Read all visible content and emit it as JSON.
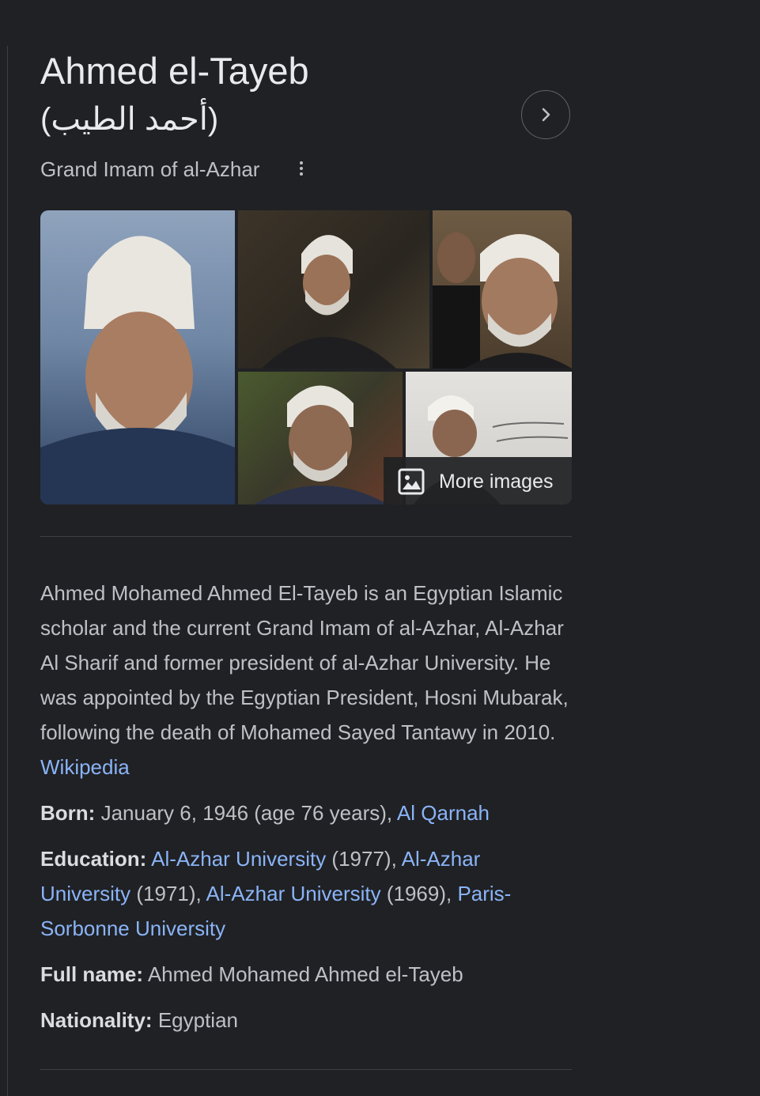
{
  "header": {
    "title": "Ahmed el-Tayeb",
    "native_name": "(أحمد الطيب)",
    "subtitle": "Grand Imam of al-Azhar",
    "next_icon": "chevron-right-icon",
    "menu_icon": "more-vert-icon"
  },
  "gallery": {
    "more_images_label": "More images",
    "more_images_icon": "image-icon"
  },
  "description": {
    "text": "Ahmed Mohamed Ahmed El-Tayeb is an Egyptian Islamic scholar and the current Grand Imam of al-Azhar, Al-Azhar Al Sharif and former president of al-Azhar University. He was appointed by the Egyptian President, Hosni Mubarak, following the death of Mohamed Sayed Tantawy in 2010.",
    "source_link": "Wikipedia"
  },
  "facts": {
    "born": {
      "label": "Born:",
      "value": "January 6, 1946 (age 76 years), ",
      "link": "Al Qarnah"
    },
    "education": {
      "label": "Education:",
      "link1": "Al-Azhar University",
      "year1": " (1977), ",
      "link2": "Al-Azhar University",
      "year2": " (1971), ",
      "link3": "Al-Azhar University",
      "year3": " (1969), ",
      "link4": "Paris-Sorbonne University"
    },
    "full_name": {
      "label": "Full name:",
      "value": "Ahmed Mohamed Ahmed el-Tayeb"
    },
    "nationality": {
      "label": "Nationality:",
      "value": "Egyptian"
    }
  },
  "colors": {
    "background": "#202124",
    "text": "#bdc1c6",
    "heading": "#e8eaed",
    "link": "#8ab4f8",
    "divider": "#3c4043"
  }
}
